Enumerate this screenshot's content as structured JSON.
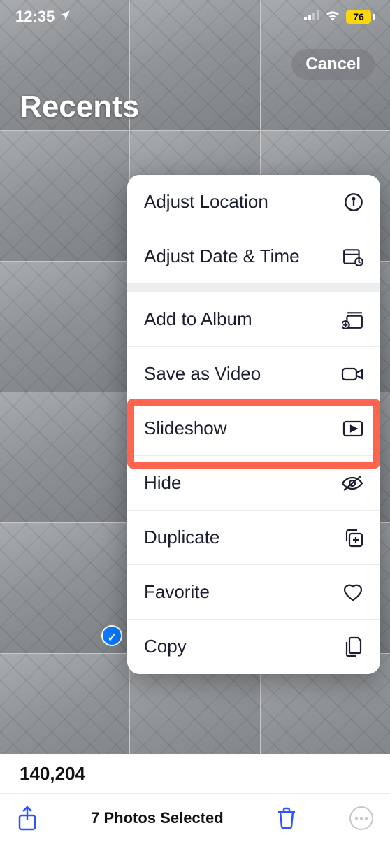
{
  "statusbar": {
    "time": "12:35",
    "battery": "76"
  },
  "header": {
    "album_title": "Recents",
    "cancel": "Cancel"
  },
  "menu": {
    "adjust_location": "Adjust Location",
    "adjust_datetime": "Adjust Date & Time",
    "add_to_album": "Add to Album",
    "save_as_video": "Save as Video",
    "slideshow": "Slideshow",
    "hide": "Hide",
    "duplicate": "Duplicate",
    "favorite": "Favorite",
    "copy": "Copy"
  },
  "footer": {
    "photo_count": "140,204",
    "selected": "7 Photos Selected"
  }
}
